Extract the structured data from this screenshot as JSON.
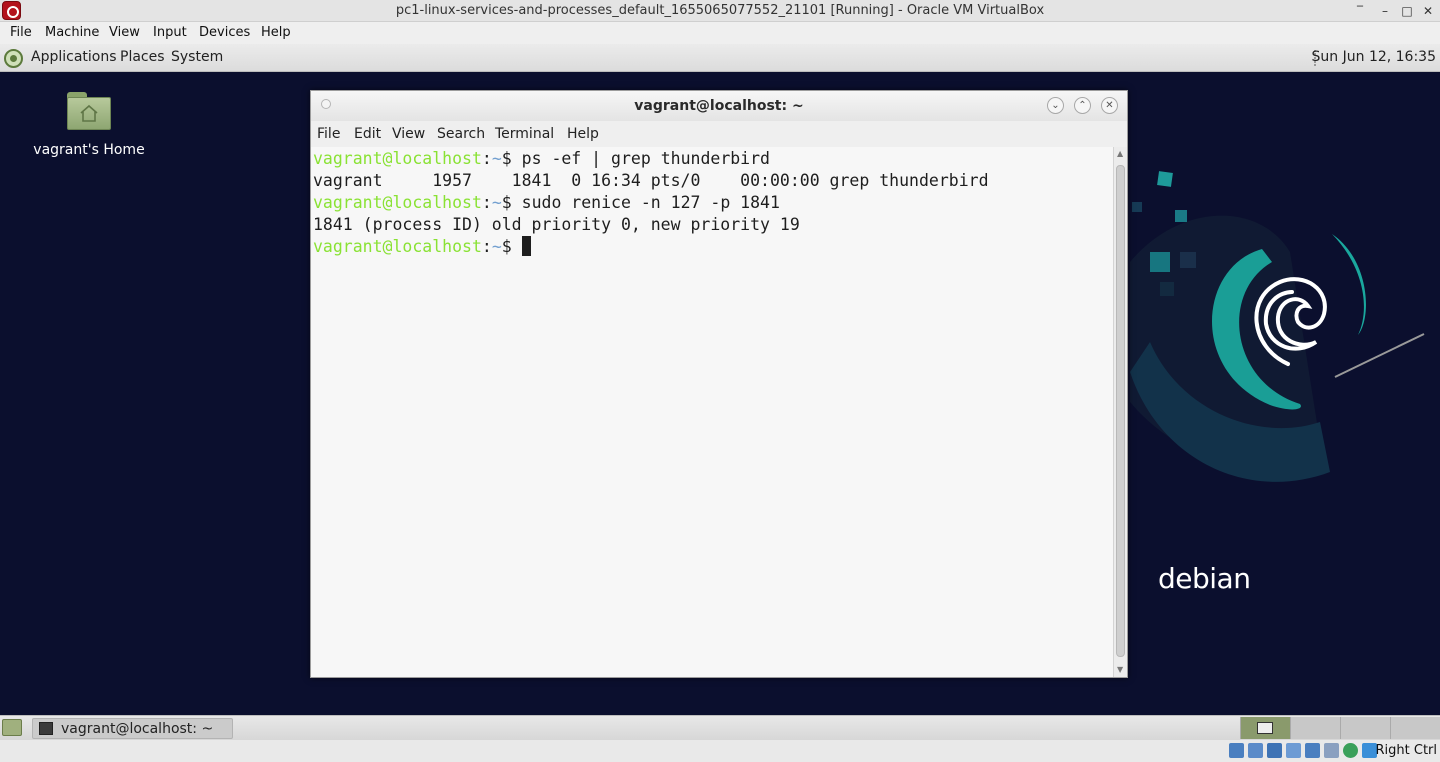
{
  "vbox": {
    "title": "pc1-linux-services-and-processes_default_1655065077552_21101 [Running] - Oracle VM VirtualBox",
    "controls": {
      "minimize": "‾",
      "restore": "–",
      "maximize": "□",
      "close": "✕"
    },
    "menu": [
      "File",
      "Machine",
      "View",
      "Input",
      "Devices",
      "Help"
    ],
    "host_key": "Right Ctrl"
  },
  "guest_panel": {
    "menus": [
      "Applications",
      "Places",
      "System"
    ],
    "clock": "Sun Jun 12, 16:35"
  },
  "desktop": {
    "home_icon_label": "vagrant's Home",
    "wallpaper_brand": "debian"
  },
  "terminal": {
    "title": "vagrant@localhost: ~",
    "menu": [
      "File",
      "Edit",
      "View",
      "Search",
      "Terminal",
      "Help"
    ],
    "lines": [
      {
        "prompt_user": "vagrant@localhost",
        "prompt_sep": ":",
        "prompt_dir": "~",
        "prompt_sym": "$ ",
        "text": "ps -ef | grep thunderbird"
      },
      {
        "text": "vagrant     1957    1841  0 16:34 pts/0    00:00:00 grep thunderbird"
      },
      {
        "prompt_user": "vagrant@localhost",
        "prompt_sep": ":",
        "prompt_dir": "~",
        "prompt_sym": "$ ",
        "text": "sudo renice -n 127 -p 1841"
      },
      {
        "text": "1841 (process ID) old priority 0, new priority 19"
      },
      {
        "prompt_user": "vagrant@localhost",
        "prompt_sep": ":",
        "prompt_dir": "~",
        "prompt_sym": "$ ",
        "text": ""
      }
    ],
    "colors": {
      "prompt": "#8ae234",
      "dir": "#729fcf",
      "text": "#1e1e1e",
      "background": "#f7f7f7"
    }
  },
  "bottom_panel": {
    "task_label": "vagrant@localhost: ~",
    "workspaces": 4
  }
}
